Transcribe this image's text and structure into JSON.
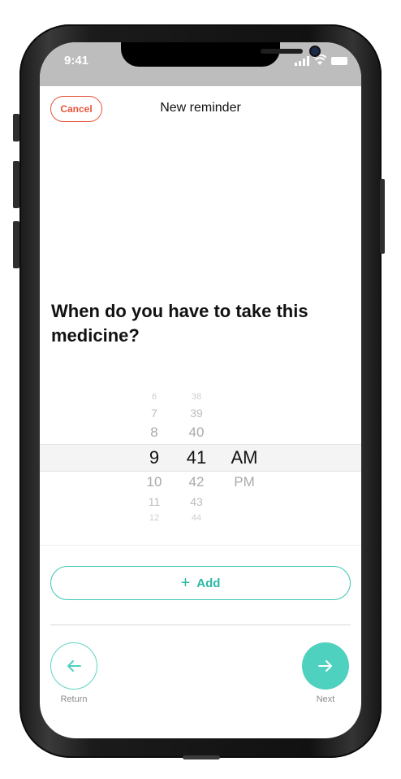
{
  "status_bar": {
    "time": "9:41"
  },
  "header": {
    "cancel_label": "Cancel",
    "title": "New reminder"
  },
  "question": "When do you have to take this medicine?",
  "time_picker": {
    "hours_above": [
      "6",
      "7",
      "8"
    ],
    "hour_selected": "9",
    "hours_below": [
      "10",
      "11",
      "12"
    ],
    "minutes_above": [
      "38",
      "39",
      "40"
    ],
    "minute_selected": "41",
    "minutes_below": [
      "42",
      "43",
      "44"
    ],
    "period_selected": "AM",
    "period_below": "PM"
  },
  "add_button": {
    "icon": "plus-icon",
    "label": "Add"
  },
  "navigation": {
    "return_label": "Return",
    "return_icon": "arrow-left-icon",
    "next_label": "Next",
    "next_icon": "arrow-right-icon"
  },
  "colors": {
    "accent": "#4fd1bf",
    "cancel": "#e8553d",
    "status_bar": "#bdbdbd"
  }
}
